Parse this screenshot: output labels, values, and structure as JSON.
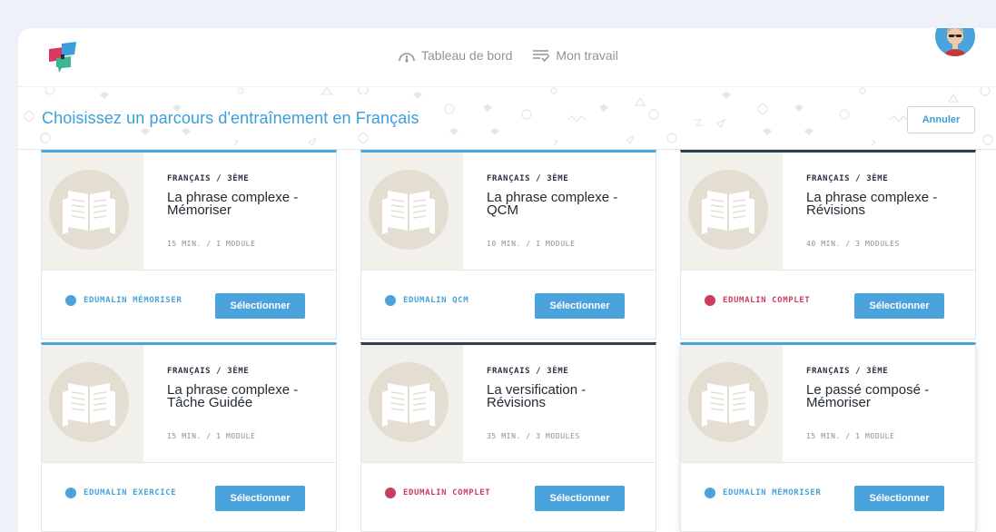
{
  "nav": {
    "dashboard_label": "Tableau de bord",
    "work_label": "Mon travail"
  },
  "banner": {
    "title": "Choisissez un parcours d'entraînement en Français",
    "cancel_label": "Annuler"
  },
  "colors": {
    "accent_blue": "#4aa3dc",
    "accent_dark": "#2f3e4c",
    "complet_red": "#cc3d5e",
    "page_bg": "#eef1f8"
  },
  "icons": {
    "logo": "edumalin-logo",
    "dashboard": "gauge-icon",
    "work": "list-check-icon",
    "avatar": "user-avatar",
    "thumbnail": "open-book-icon"
  },
  "cards": [
    {
      "category": "FRANÇAIS / 3ÈME",
      "title_line1": "La phrase complexe -",
      "title_line2": "Mémoriser",
      "meta": "15 MIN. / 1 MODULE",
      "type": "EDUMALIN MÉMORISER",
      "type_color": "#4aa3dc",
      "accent": "blue",
      "select_label": "Sélectionner"
    },
    {
      "category": "FRANÇAIS / 3ÈME",
      "title_line1": "La phrase complexe -",
      "title_line2": "QCM",
      "meta": "10 MIN. / 1 MODULE",
      "type": "EDUMALIN QCM",
      "type_color": "#4aa3dc",
      "accent": "blue",
      "select_label": "Sélectionner"
    },
    {
      "category": "FRANÇAIS / 3ÈME",
      "title_line1": "La phrase complexe -",
      "title_line2": "Révisions",
      "meta": "40 MIN. / 3 MODULES",
      "type": "EDUMALIN COMPLET",
      "type_color": "#cc3d5e",
      "accent": "dark",
      "select_label": "Sélectionner"
    },
    {
      "category": "FRANÇAIS / 3ÈME",
      "title_line1": "La phrase complexe -",
      "title_line2": "Tâche Guidée",
      "meta": "15 MIN. / 1 MODULE",
      "type": "EDUMALIN EXERCICE",
      "type_color": "#4aa3dc",
      "accent": "blue",
      "select_label": "Sélectionner"
    },
    {
      "category": "FRANÇAIS / 3ÈME",
      "title_line1": "La versification -",
      "title_line2": "Révisions",
      "meta": "35 MIN. / 3 MODULES",
      "type": "EDUMALIN COMPLET",
      "type_color": "#cc3d5e",
      "accent": "dark",
      "select_label": "Sélectionner"
    },
    {
      "category": "FRANÇAIS / 3ÈME",
      "title_line1": "Le passé composé -",
      "title_line2": "Mémoriser",
      "meta": "15 MIN. / 1 MODULE",
      "type": "EDUMALIN MÉMORISER",
      "type_color": "#4aa3dc",
      "accent": "blue",
      "select_label": "Sélectionner"
    }
  ]
}
